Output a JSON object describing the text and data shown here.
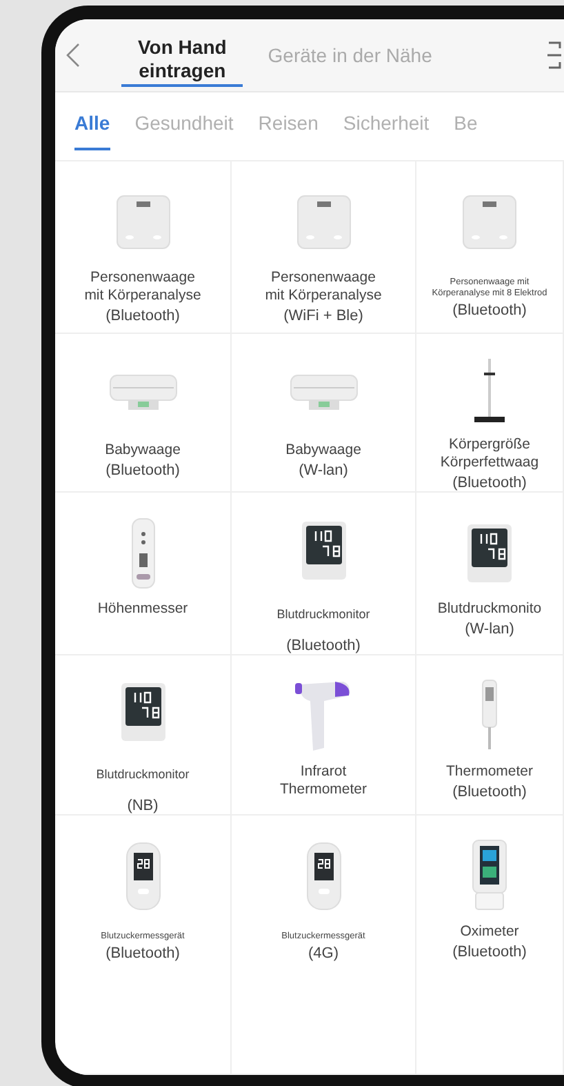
{
  "header": {
    "tabs": [
      {
        "label": "Von Hand\neintragen",
        "selected": true
      },
      {
        "label": "Geräte in der Nähe",
        "selected": false
      }
    ]
  },
  "categories": [
    {
      "label": "Alle",
      "selected": true
    },
    {
      "label": "Gesundheit",
      "selected": false
    },
    {
      "label": "Reisen",
      "selected": false
    },
    {
      "label": "Sicherheit",
      "selected": false
    },
    {
      "label": "Be",
      "selected": false
    }
  ],
  "devices": [
    {
      "kind": "scale",
      "name": "Personenwaage\nmit Körperanalyse",
      "note": "(Bluetooth)"
    },
    {
      "kind": "scale",
      "name": "Personenwaage\nmit Körperanalyse",
      "note": "(WiFi + Ble)"
    },
    {
      "kind": "scale",
      "name": "Personenwaage mit\nKörperanalyse mit 8 Elektrod",
      "note": "(Bluetooth)",
      "fine_print": true
    },
    {
      "kind": "baby-scale",
      "name": "Babywaage",
      "note": "(Bluetooth)"
    },
    {
      "kind": "baby-scale",
      "name": "Babywaage",
      "note": "(W-lan)"
    },
    {
      "kind": "height-scale",
      "name": "Körpergröße\nKörperfettwaag",
      "note": "(Bluetooth)"
    },
    {
      "kind": "height-meter",
      "name": "Höhenmesser"
    },
    {
      "kind": "bp-monitor",
      "name": "Blutdruckmonitor",
      "note": "(Bluetooth)",
      "spaced": true
    },
    {
      "kind": "bp-monitor",
      "name": "Blutdruckmonito",
      "note": "(W-lan)"
    },
    {
      "kind": "bp-monitor",
      "name": "Blutdruckmonitor",
      "note": "(NB)",
      "spaced": true
    },
    {
      "kind": "ir-thermometer",
      "name": "Infrarot\nThermometer"
    },
    {
      "kind": "thermometer",
      "name": "Thermometer",
      "note": "(Bluetooth)"
    },
    {
      "kind": "glucose-meter",
      "name": "Blutzuckermessgerät",
      "note": "(Bluetooth)",
      "fine_print": true
    },
    {
      "kind": "glucose-meter",
      "name": "Blutzuckermessgerät",
      "note": "(4G)",
      "fine_print": true
    },
    {
      "kind": "oximeter",
      "name": "Oximeter",
      "note": "(Bluetooth)"
    }
  ]
}
